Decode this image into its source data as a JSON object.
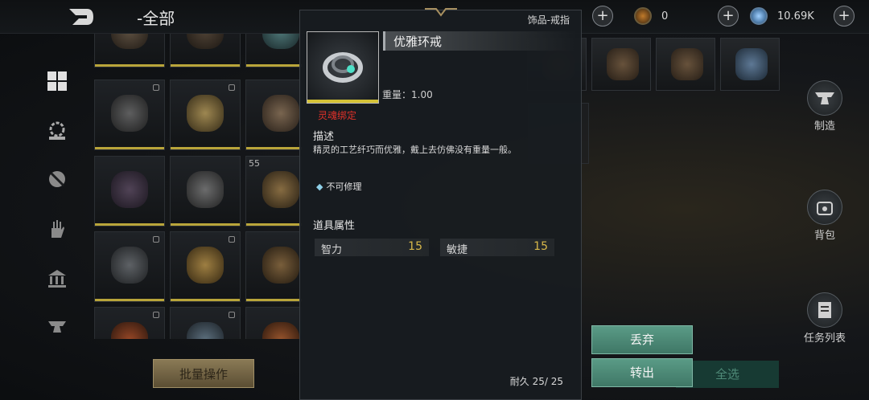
{
  "topbar": {
    "title": "-全部",
    "currencies": [
      {
        "icon": "coin-icon",
        "value": "0"
      },
      {
        "icon": "gem-icon",
        "value": "10.69K"
      }
    ]
  },
  "leftnav": {
    "items": [
      "grid-view-icon",
      "gear-shield-icon",
      "no-entry-icon",
      "hand-icon",
      "bank-icon",
      "anvil-icon"
    ]
  },
  "grid": {
    "level_label": "55"
  },
  "actions": {
    "batch_label": "批量操作",
    "select_all_label": "全选",
    "discard_label": "丢弃",
    "transfer_label": "转出"
  },
  "side_tools": [
    {
      "label": "制造",
      "icon": "anvil-icon"
    },
    {
      "label": "背包",
      "icon": "bag-icon"
    },
    {
      "label": "任务列表",
      "icon": "scroll-icon"
    }
  ],
  "tooltip": {
    "category": "饰品-戒指",
    "name": "优雅环戒",
    "weight": "重量：1.00",
    "bound": "灵魂绑定",
    "desc_header": "描述",
    "desc_text": "精灵的工艺纤巧而优雅，戴上去仿佛没有重量一般。",
    "repair": "不可修理",
    "props_header": "道具属性",
    "props": [
      {
        "name": "智力",
        "value": "15"
      },
      {
        "name": "敏捷",
        "value": "15"
      }
    ],
    "durability": "耐久 25/ 25"
  },
  "colors": {
    "quality": "#d4c236",
    "accent_green": "#4f8f7b",
    "bound_red": "#e0312a",
    "stat_gold": "#d8b84a"
  }
}
